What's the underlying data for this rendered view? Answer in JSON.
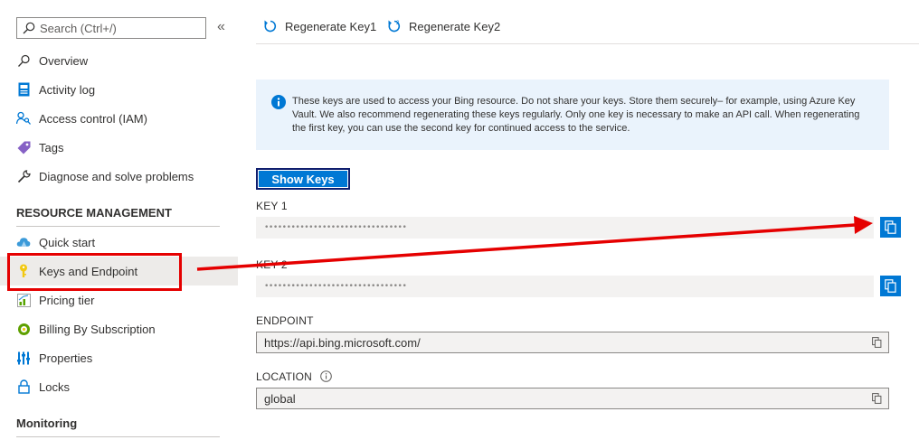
{
  "sidebar": {
    "search_placeholder": "Search (Ctrl+/)",
    "collapse_glyph": "«",
    "items": [
      {
        "label": "Overview",
        "icon": "overview-icon"
      },
      {
        "label": "Activity log",
        "icon": "activity-log-icon"
      },
      {
        "label": "Access control (IAM)",
        "icon": "iam-icon"
      },
      {
        "label": "Tags",
        "icon": "tag-icon"
      },
      {
        "label": "Diagnose and solve problems",
        "icon": "wrench-icon"
      }
    ],
    "section_resource": "RESOURCE MANAGEMENT",
    "resource_items": [
      {
        "label": "Quick start",
        "icon": "cloud-icon"
      },
      {
        "label": "Keys and Endpoint",
        "icon": "key-icon",
        "active": true
      },
      {
        "label": "Pricing tier",
        "icon": "pricing-icon"
      },
      {
        "label": "Billing By Subscription",
        "icon": "billing-icon"
      },
      {
        "label": "Properties",
        "icon": "properties-icon"
      },
      {
        "label": "Locks",
        "icon": "lock-icon"
      }
    ],
    "section_monitoring": "Monitoring"
  },
  "toolbar": {
    "regenerate_key1": "Regenerate Key1",
    "regenerate_key2": "Regenerate Key2"
  },
  "info": {
    "text": "These keys are used to access your Bing resource. Do not share your keys. Store them securely– for example, using Azure Key Vault. We also recommend regenerating these keys regularly. Only one key is necessary to make an API call. When regenerating the first key, you can use the second key for continued access to the service."
  },
  "show_keys_label": "Show Keys",
  "key1": {
    "label": "KEY 1",
    "value": "••••••••••••••••••••••••••••••••"
  },
  "key2": {
    "label": "KEY 2",
    "value": "••••••••••••••••••••••••••••••••"
  },
  "endpoint": {
    "label": "ENDPOINT",
    "value": "https://api.bing.microsoft.com/"
  },
  "location": {
    "label": "LOCATION",
    "value": "global"
  },
  "colors": {
    "accent": "#0078d4",
    "annotation": "#e50000",
    "info_bg": "#eaf3fc",
    "active_bg": "#edebe9"
  }
}
